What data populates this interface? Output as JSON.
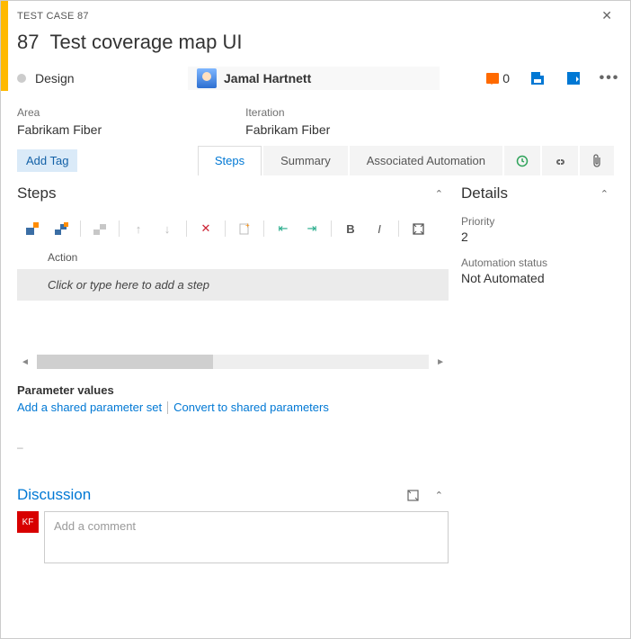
{
  "header": {
    "type_label": "TEST CASE 87",
    "id": "87",
    "title": "Test coverage map UI"
  },
  "meta": {
    "state": "Design",
    "assignee": "Jamal Hartnett",
    "comment_count": "0"
  },
  "fields": {
    "area_label": "Area",
    "area_value": "Fabrikam Fiber",
    "iteration_label": "Iteration",
    "iteration_value": "Fabrikam Fiber"
  },
  "tags": {
    "add_label": "Add Tag"
  },
  "tabs": {
    "steps": "Steps",
    "summary": "Summary",
    "automation": "Associated Automation"
  },
  "steps": {
    "section_title": "Steps",
    "col_action": "Action",
    "placeholder": "Click or type here to add a step"
  },
  "params": {
    "title": "Parameter values",
    "add_shared": "Add a shared parameter set",
    "convert": "Convert to shared parameters"
  },
  "discussion": {
    "title": "Discussion",
    "avatar_initials": "KF",
    "placeholder": "Add a comment"
  },
  "details": {
    "title": "Details",
    "priority_label": "Priority",
    "priority_value": "2",
    "auto_label": "Automation status",
    "auto_value": "Not Automated"
  }
}
